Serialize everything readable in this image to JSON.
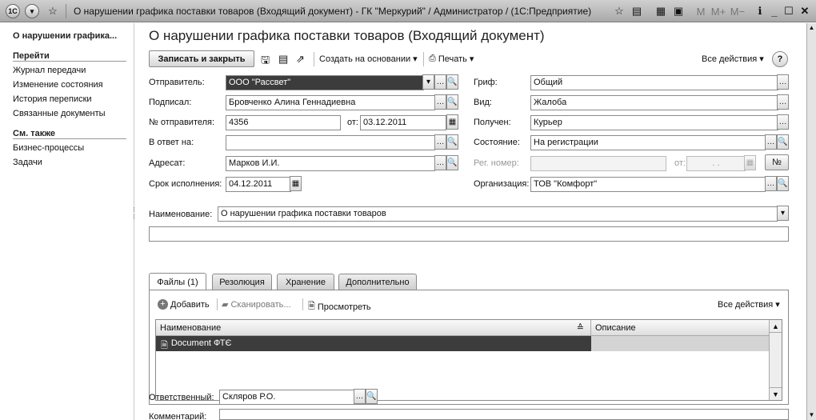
{
  "window": {
    "title": "О нарушении графика поставки товаров (Входящий документ) - ГК \"Меркурий\" / Администратор /  (1С:Предприятие)",
    "logo": "1С",
    "calc_m": "M",
    "calc_mplus": "M+",
    "calc_mminus": "M−"
  },
  "sidebar": {
    "doc_title": "О нарушении графика...",
    "goto_header": "Перейти",
    "goto_items": [
      "Журнал передачи",
      "Изменение состояния",
      "История переписки",
      "Связанные документы"
    ],
    "see_also_header": "См. также",
    "see_also_items": [
      "Бизнес-процессы",
      "Задачи"
    ]
  },
  "form": {
    "title": "О нарушении графика поставки товаров (Входящий документ)",
    "toolbar": {
      "save_close": "Записать и закрыть",
      "create_based": "Создать на основании",
      "print": "Печать",
      "all_actions": "Все действия",
      "help": "?"
    },
    "fields": {
      "sender_label": "Отправитель:",
      "sender_value": "ООО \"Рассвет\"",
      "signed_label": "Подписал:",
      "signed_value": "Бровченко Алина Геннадиевна",
      "sender_no_label": "№ отправителя:",
      "sender_no_value": "4356",
      "from_label": "от:",
      "from_value": "03.12.2011",
      "reply_label": "В ответ на:",
      "reply_value": "",
      "addressee_label": "Адресат:",
      "addressee_value": "Марков И.И.",
      "deadline_label": "Срок исполнения:",
      "deadline_value": "04.12.2011",
      "grif_label": "Гриф:",
      "grif_value": "Общий",
      "kind_label": "Вид:",
      "kind_value": "Жалоба",
      "received_label": "Получен:",
      "received_value": "Курьер",
      "state_label": "Состояние:",
      "state_value": "На регистрации",
      "reg_label": "Рег. номер:",
      "reg_value": "",
      "reg_from_label": "от:",
      "reg_from_value": ". .",
      "number_btn": "№",
      "org_label": "Организация:",
      "org_value": "ТОВ \"Комфорт\"",
      "name_label": "Наименование:",
      "name_value": "О нарушении графика поставки товаров",
      "responsible_label": "Ответственный:",
      "responsible_value": "Скляров Р.О.",
      "comment_label": "Комментарий:"
    },
    "tabs": [
      "Файлы (1)",
      "Резолюция",
      "Хранение",
      "Дополнительно"
    ],
    "files": {
      "add": "Добавить",
      "scan": "Сканировать...",
      "view": "Просмотреть",
      "all_actions": "Все действия",
      "columns": [
        "Наименование",
        "Описание"
      ],
      "rows": [
        {
          "name": "Document ФТЄ",
          "description": ""
        }
      ]
    }
  }
}
